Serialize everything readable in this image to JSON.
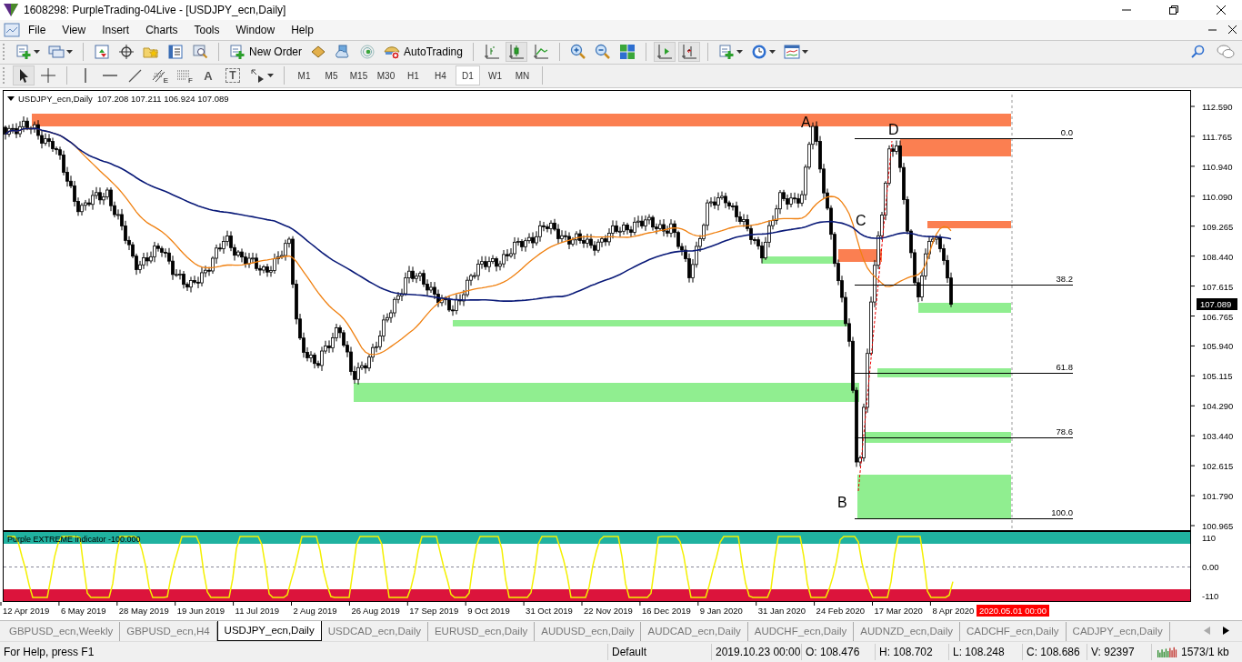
{
  "window": {
    "title": "1608298: PurpleTrading-04Live - [USDJPY_ecn,Daily]"
  },
  "menu": [
    "File",
    "View",
    "Insert",
    "Charts",
    "Tools",
    "Window",
    "Help"
  ],
  "toolbar": [
    {
      "kind": "new-chart",
      "dropdown": true,
      "on": false
    },
    {
      "kind": "profiles",
      "dropdown": true,
      "on": false
    },
    {
      "kind": "sep"
    },
    {
      "kind": "market-watch",
      "on": false
    },
    {
      "kind": "navigator",
      "on": false
    },
    {
      "kind": "favorites",
      "on": false
    },
    {
      "kind": "data-window",
      "on": false
    },
    {
      "kind": "tester",
      "on": false
    },
    {
      "kind": "sep"
    },
    {
      "kind": "new-order",
      "label": "New Order",
      "on": false
    },
    {
      "kind": "editor",
      "on": false
    },
    {
      "kind": "cloud",
      "on": false
    },
    {
      "kind": "signals",
      "on": false
    },
    {
      "kind": "autotrading",
      "label": "AutoTrading",
      "on": false
    },
    {
      "kind": "sep"
    },
    {
      "kind": "bar-chart",
      "on": false
    },
    {
      "kind": "candle-chart",
      "on": true
    },
    {
      "kind": "line-chart",
      "on": false
    },
    {
      "kind": "sep"
    },
    {
      "kind": "zoom-in",
      "on": false
    },
    {
      "kind": "zoom-out",
      "on": false
    },
    {
      "kind": "tile",
      "on": false
    },
    {
      "kind": "sep"
    },
    {
      "kind": "autoscroll",
      "on": true
    },
    {
      "kind": "chart-shift",
      "on": true
    },
    {
      "kind": "sep"
    },
    {
      "kind": "template",
      "dropdown": true,
      "on": false
    },
    {
      "kind": "clock",
      "dropdown": true,
      "on": false
    },
    {
      "kind": "indicators",
      "dropdown": true,
      "on": false
    }
  ],
  "tools": [
    {
      "kind": "cursor",
      "on": true
    },
    {
      "kind": "crosshair",
      "on": false
    },
    {
      "kind": "sep"
    },
    {
      "kind": "vline",
      "on": false
    },
    {
      "kind": "hline",
      "on": false
    },
    {
      "kind": "trendline",
      "on": false
    },
    {
      "kind": "channel",
      "label": "E",
      "on": false
    },
    {
      "kind": "fibo",
      "label": "F",
      "on": false
    },
    {
      "kind": "text",
      "label": "A",
      "on": false
    },
    {
      "kind": "text-label",
      "label": "T",
      "on": false
    },
    {
      "kind": "arrows",
      "dropdown": true,
      "on": false
    }
  ],
  "timeframes": [
    {
      "label": "M1",
      "selected": false
    },
    {
      "label": "M5",
      "selected": false
    },
    {
      "label": "M15",
      "selected": false
    },
    {
      "label": "M30",
      "selected": false
    },
    {
      "label": "H1",
      "selected": false
    },
    {
      "label": "H4",
      "selected": false
    },
    {
      "label": "D1",
      "selected": true
    },
    {
      "label": "W1",
      "selected": false
    },
    {
      "label": "MN",
      "selected": false
    }
  ],
  "chart": {
    "symbol": "USDJPY_ecn,Daily",
    "ohlc": "107.208 107.211 106.924 107.089",
    "price_ticks": [
      "112.590",
      "111.765",
      "110.940",
      "110.090",
      "109.265",
      "108.440",
      "107.615",
      "106.765",
      "105.940",
      "105.115",
      "104.290",
      "103.440",
      "102.615",
      "101.790",
      "100.965"
    ],
    "current_price": "107.089",
    "points": [
      "A",
      "D",
      "C",
      "B"
    ],
    "fib_levels": [
      "0.0",
      "38.2",
      "61.8",
      "78.6",
      "100.0"
    ],
    "indicator": {
      "label": "Purple EXTREME indicator -100.000",
      "ticks": [
        "110",
        "0.00",
        "-110"
      ]
    },
    "dates": [
      "12 Apr 2019",
      "6 May 2019",
      "28 May 2019",
      "19 Jun 2019",
      "11 Jul 2019",
      "2 Aug 2019",
      "26 Aug 2019",
      "17 Sep 2019",
      "9 Oct 2019",
      "31 Oct 2019",
      "22 Nov 2019",
      "16 Dec 2019",
      "9 Jan 2020",
      "31 Jan 2020",
      "24 Feb 2020",
      "17 Mar 2020",
      "8 Apr 2020"
    ],
    "cursor_date": "2020.05.01 00:00"
  },
  "tabs": [
    {
      "label": "GBPUSD_ecn,Weekly",
      "selected": false
    },
    {
      "label": "GBPUSD_ecn,H4",
      "selected": false
    },
    {
      "label": "USDJPY_ecn,Daily",
      "selected": true
    },
    {
      "label": "USDCAD_ecn,Daily",
      "selected": false
    },
    {
      "label": "EURUSD_ecn,Daily",
      "selected": false
    },
    {
      "label": "AUDUSD_ecn,Daily",
      "selected": false
    },
    {
      "label": "AUDCAD_ecn,Daily",
      "selected": false
    },
    {
      "label": "AUDCHF_ecn,Daily",
      "selected": false
    },
    {
      "label": "AUDNZD_ecn,Daily",
      "selected": false
    },
    {
      "label": "CADCHF_ecn,Daily",
      "selected": false
    },
    {
      "label": "CADJPY_ecn,Daily",
      "selected": false
    }
  ],
  "status_bar": {
    "help": "For Help, press F1",
    "profile": "Default",
    "time": "2019.10.23 00:00",
    "open": "O: 108.476",
    "high": "H: 108.702",
    "low": "L: 108.248",
    "close": "C: 108.686",
    "volume": "V: 92397",
    "traffic": "1573/1 kb"
  }
}
